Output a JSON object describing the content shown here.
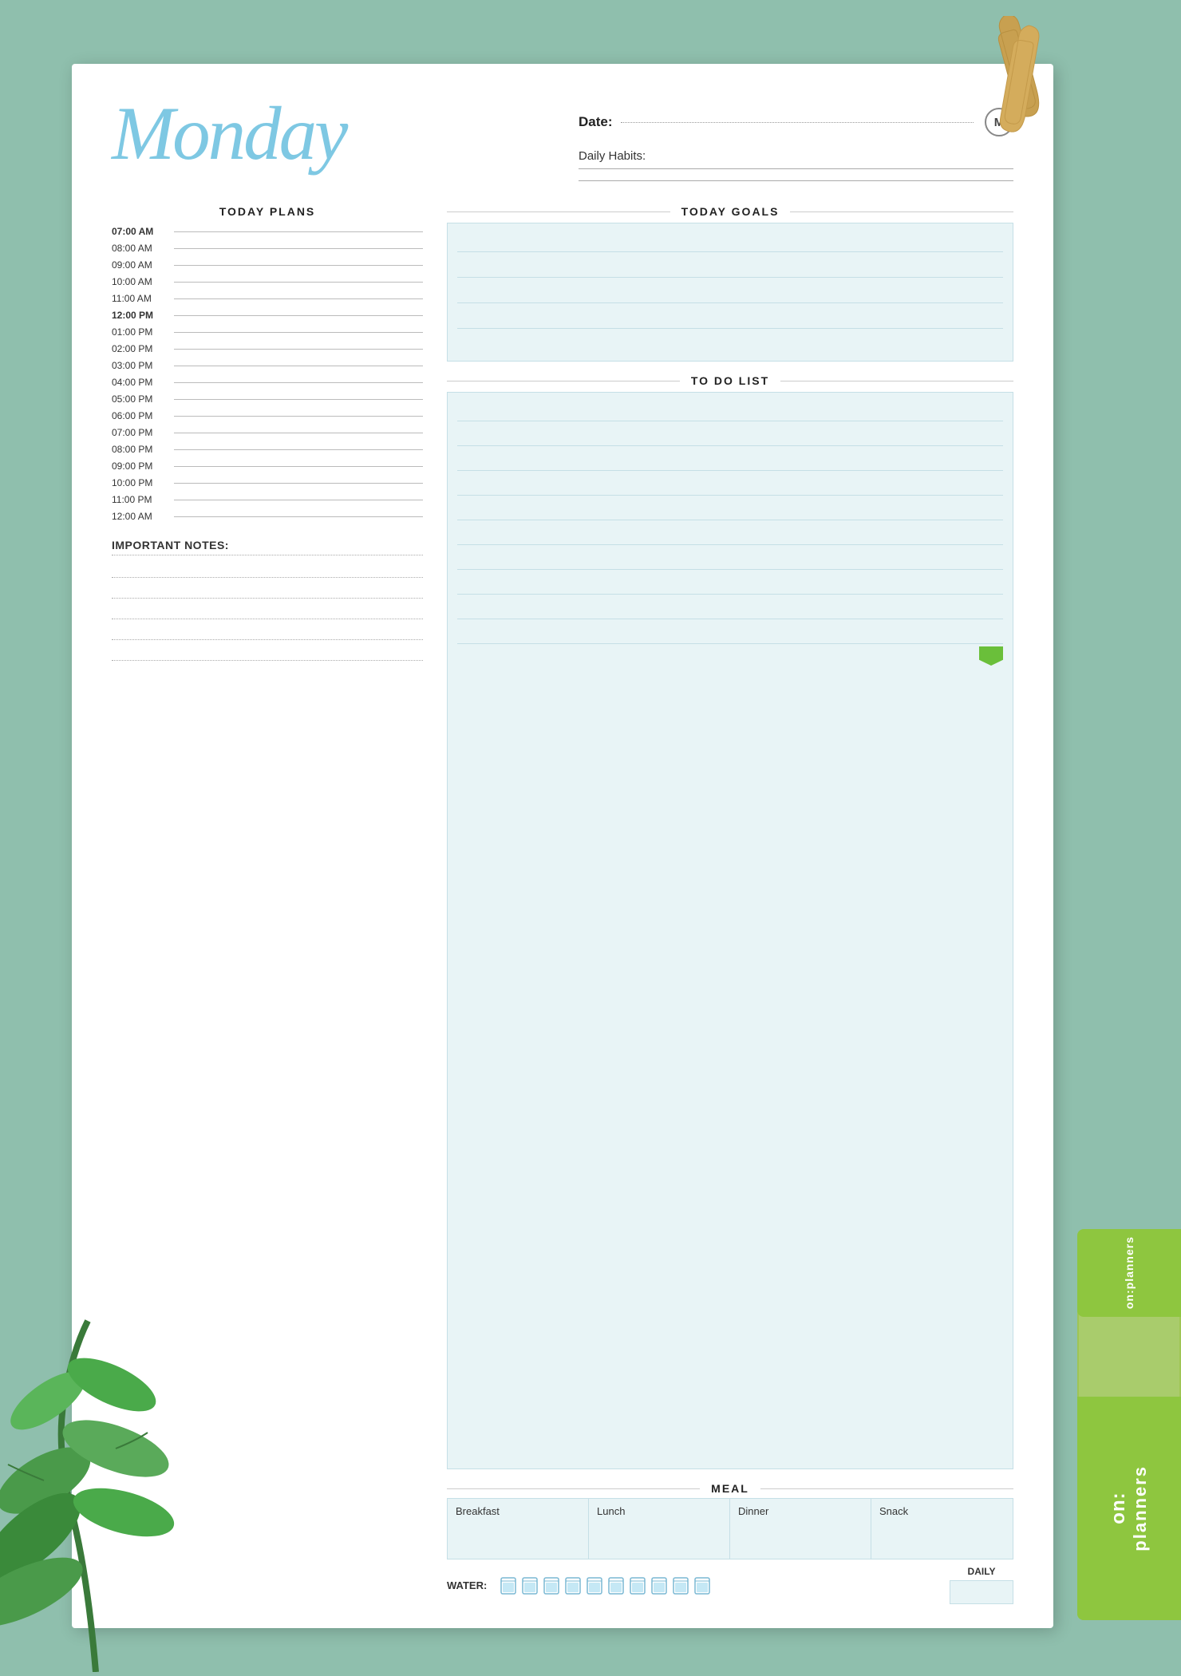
{
  "background": {
    "color": "#8fbfad"
  },
  "header": {
    "day": "Monday",
    "date_label": "Date:",
    "monday_initial": "M",
    "habits_label": "Daily Habits:"
  },
  "schedule": {
    "title": "TODAY PLANS",
    "times": [
      {
        "time": "07:00 AM",
        "bold": true
      },
      {
        "time": "08:00 AM",
        "bold": false
      },
      {
        "time": "09:00 AM",
        "bold": false
      },
      {
        "time": "10:00 AM",
        "bold": false
      },
      {
        "time": "11:00 AM",
        "bold": false
      },
      {
        "time": "12:00 PM",
        "bold": true
      },
      {
        "time": "01:00 PM",
        "bold": false
      },
      {
        "time": "02:00 PM",
        "bold": false
      },
      {
        "time": "03:00 PM",
        "bold": false
      },
      {
        "time": "04:00 PM",
        "bold": false
      },
      {
        "time": "05:00 PM",
        "bold": false
      },
      {
        "time": "06:00 PM",
        "bold": false
      },
      {
        "time": "07:00 PM",
        "bold": false
      },
      {
        "time": "08:00 PM",
        "bold": false
      },
      {
        "time": "09:00 PM",
        "bold": false
      },
      {
        "time": "10:00 PM",
        "bold": false
      },
      {
        "time": "11:00 PM",
        "bold": false
      },
      {
        "time": "12:00 AM",
        "bold": false
      }
    ]
  },
  "goals": {
    "title": "TODAY GOALS",
    "lines": 5
  },
  "todo": {
    "title": "TO DO LIST",
    "lines": 12
  },
  "meal": {
    "title": "MEAL",
    "categories": [
      "Breakfast",
      "Lunch",
      "Dinner",
      "Snack"
    ]
  },
  "water": {
    "label": "WATER:",
    "cups": 10
  },
  "daily": {
    "label": "DAILY"
  },
  "notes": {
    "label": "IMPORTANT NOTES:",
    "lines": 5
  },
  "brand": {
    "prefix": "on:",
    "name": "planners"
  }
}
